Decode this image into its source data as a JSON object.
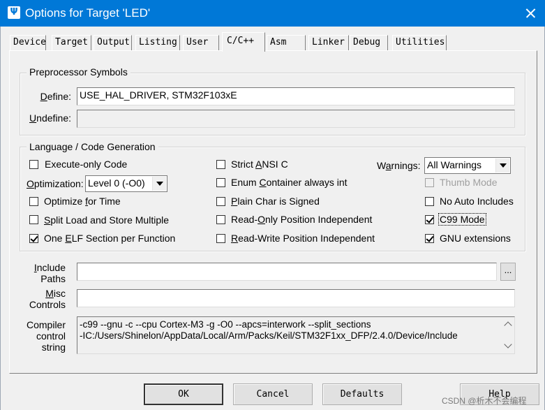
{
  "window": {
    "title": "Options for Target 'LED'",
    "icon": "keil-uvision-icon",
    "close": "close-icon"
  },
  "tabs": [
    {
      "label": "Device",
      "active": false
    },
    {
      "label": "Target",
      "active": false
    },
    {
      "label": "Output",
      "active": false
    },
    {
      "label": "Listing",
      "active": false
    },
    {
      "label": "User",
      "active": false
    },
    {
      "label": "C/C++",
      "active": true
    },
    {
      "label": "Asm",
      "active": false
    },
    {
      "label": "Linker",
      "active": false
    },
    {
      "label": "Debug",
      "active": false
    },
    {
      "label": "Utilities",
      "active": false
    }
  ],
  "preprocessor": {
    "group_label": "Preprocessor Symbols",
    "define_label": "Define:",
    "define_value": "USE_HAL_DRIVER, STM32F103xE",
    "undefine_label": "Undefine:",
    "undefine_value": ""
  },
  "codegen": {
    "group_label": "Language / Code Generation",
    "execute_only": {
      "label": "Execute-only Code",
      "checked": false
    },
    "optimization_label": "Optimization:",
    "optimization_value": "Level 0 (-O0)",
    "optimize_time": {
      "label": "Optimize for Time",
      "checked": false
    },
    "split_load_store": {
      "label": "Split Load and Store Multiple",
      "checked": false
    },
    "one_elf_section": {
      "label": "One ELF Section per Function",
      "checked": true
    },
    "strict_ansi": {
      "label": "Strict ANSI C",
      "checked": false
    },
    "enum_container": {
      "label": "Enum Container always int",
      "checked": false
    },
    "plain_char_signed": {
      "label": "Plain Char is Signed",
      "checked": false
    },
    "ro_position_independent": {
      "label": "Read-Only Position Independent",
      "checked": false
    },
    "rw_position_independent": {
      "label": "Read-Write Position Independent",
      "checked": false
    },
    "warnings_label": "Warnings:",
    "warnings_value": "All Warnings",
    "thumb_mode": {
      "label": "Thumb Mode",
      "checked": false,
      "disabled": true
    },
    "no_auto_includes": {
      "label": "No Auto Includes",
      "checked": false
    },
    "c99_mode": {
      "label": "C99 Mode",
      "checked": true
    },
    "gnu_extensions": {
      "label": "GNU extensions",
      "checked": true
    }
  },
  "paths": {
    "include_label_1": "Include",
    "include_label_2": "Paths",
    "include_value": "",
    "browse_label": "...",
    "misc_label_1": "Misc",
    "misc_label_2": "Controls",
    "misc_value": ""
  },
  "compiler": {
    "label_1": "Compiler",
    "label_2": "control",
    "label_3": "string",
    "line_1": "-c99 --gnu -c --cpu Cortex-M3 -g -O0 --apcs=interwork --split_sections",
    "line_2": "-IC:/Users/Shinelon/AppData/Local/Arm/Packs/Keil/STM32F1xx_DFP/2.4.0/Device/Include"
  },
  "buttons": {
    "ok": "OK",
    "cancel": "Cancel",
    "defaults": "Defaults",
    "help": "Help"
  },
  "watermark": "CSDN @析木不会编程"
}
